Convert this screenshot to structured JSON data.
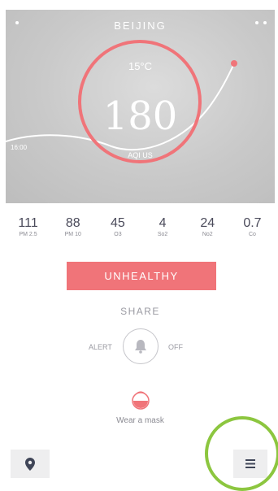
{
  "header": {
    "city": "BEIJING",
    "temperature": "15°C",
    "aqi": "180",
    "aqi_label": "AQI US",
    "time_label": "16:00"
  },
  "pollutants": [
    {
      "value": "111",
      "label": "PM 2.5"
    },
    {
      "value": "88",
      "label": "PM 10"
    },
    {
      "value": "45",
      "label": "O3"
    },
    {
      "value": "4",
      "label": "So2"
    },
    {
      "value": "24",
      "label": "No2"
    },
    {
      "value": "0.7",
      "label": "Co"
    }
  ],
  "status": {
    "label": "UNHEALTHY",
    "color": "#f07479"
  },
  "share": {
    "label": "SHARE"
  },
  "alert": {
    "left_label": "ALERT",
    "right_label": "OFF",
    "icon": "bell-icon"
  },
  "advice": {
    "label": "Wear a mask",
    "icon": "mask-icon"
  },
  "nav": {
    "location_icon": "location-pin-icon",
    "menu_icon": "menu-icon"
  },
  "colors": {
    "accent": "#f07479",
    "highlight_ring": "#8cc63f"
  }
}
